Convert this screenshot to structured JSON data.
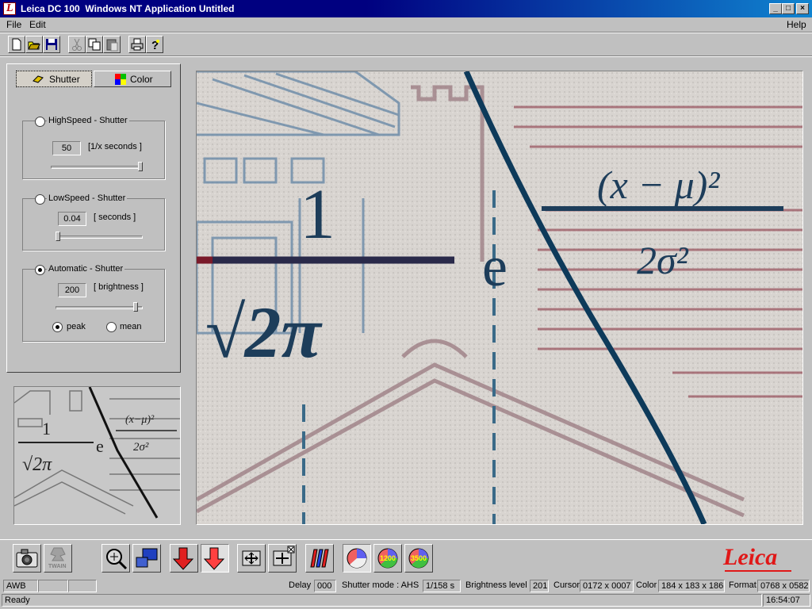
{
  "window": {
    "title": "Leica DC 100  Windows NT Application Untitled",
    "app_icon": "leica-l-icon",
    "controls": [
      "minimize",
      "maximize",
      "close"
    ]
  },
  "menu": {
    "file": "File",
    "edit": "Edit",
    "help": "Help"
  },
  "toolbar": [
    "new-icon",
    "open-icon",
    "save-icon",
    "cut-icon",
    "copy-icon",
    "paste-icon",
    "print-icon",
    "help-icon"
  ],
  "tabs": {
    "shutter": "Shutter",
    "color": "Color"
  },
  "highspeed": {
    "label": "HighSpeed - Shutter",
    "value": "50",
    "unit": "[1/x  seconds ]"
  },
  "lowspeed": {
    "label": "LowSpeed - Shutter",
    "value": "0.04",
    "unit": "[ seconds ]"
  },
  "automatic": {
    "label": "Automatic - Shutter",
    "value": "200",
    "unit": "[ brightness ]",
    "peak": "peak",
    "mean": "mean"
  },
  "bottom_toolbar": {
    "twain": "TWAIN",
    "color1": "1200",
    "color2": "3500",
    "logo": "Leica"
  },
  "status": {
    "awb": "AWB",
    "delay_label": "Delay",
    "delay": "000",
    "shutter_mode": "Shutter mode : AHS",
    "shutter_time": "1/158 s",
    "brightness_label": "Brightness level",
    "brightness": "201",
    "cursor_label": "Cursor",
    "cursor": "0172 x 0007",
    "color_label": "Color",
    "color": "184 x 183 x 186",
    "format_label": "Format",
    "format": "0768 x 0582",
    "ready": "Ready",
    "time": "16:54:07"
  },
  "image_formula": {
    "one": "1",
    "sqrt": "√2π",
    "sigma": "σ",
    "e": "e",
    "exponent_num": "(x − μ)²",
    "exponent_den": "2σ²"
  }
}
